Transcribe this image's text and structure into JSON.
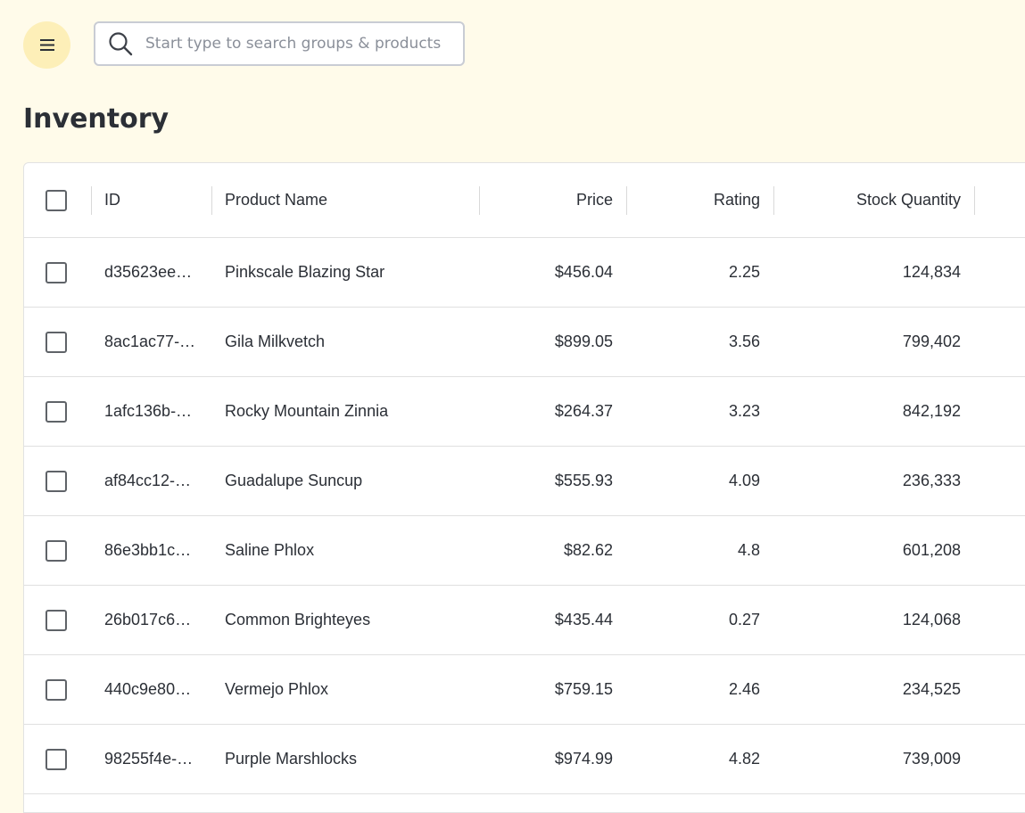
{
  "header": {
    "search_placeholder": "Start type to search groups & products"
  },
  "page": {
    "title": "Inventory"
  },
  "table": {
    "columns": [
      "ID",
      "Product Name",
      "Price",
      "Rating",
      "Stock Quantity"
    ],
    "rows": [
      {
        "id": "d35623ee…",
        "name": "Pinkscale Blazing Star",
        "price": "$456.04",
        "rating": "2.25",
        "stock": "124,834"
      },
      {
        "id": "8ac1ac77-…",
        "name": "Gila Milkvetch",
        "price": "$899.05",
        "rating": "3.56",
        "stock": "799,402"
      },
      {
        "id": "1afc136b-…",
        "name": "Rocky Mountain Zinnia",
        "price": "$264.37",
        "rating": "3.23",
        "stock": "842,192"
      },
      {
        "id": "af84cc12-…",
        "name": "Guadalupe Suncup",
        "price": "$555.93",
        "rating": "4.09",
        "stock": "236,333"
      },
      {
        "id": "86e3bb1c…",
        "name": "Saline Phlox",
        "price": "$82.62",
        "rating": "4.8",
        "stock": "601,208"
      },
      {
        "id": "26b017c6…",
        "name": "Common Brighteyes",
        "price": "$435.44",
        "rating": "0.27",
        "stock": "124,068"
      },
      {
        "id": "440c9e80…",
        "name": "Vermejo Phlox",
        "price": "$759.15",
        "rating": "2.46",
        "stock": "234,525"
      },
      {
        "id": "98255f4e-…",
        "name": "Purple Marshlocks",
        "price": "$974.99",
        "rating": "4.82",
        "stock": "739,009"
      }
    ]
  },
  "icons": {
    "menu": "menu-icon",
    "search": "search-icon"
  },
  "colors": {
    "background": "#fffbea",
    "menu_button_bg": "#fdefb8",
    "text": "#2b2f36"
  }
}
